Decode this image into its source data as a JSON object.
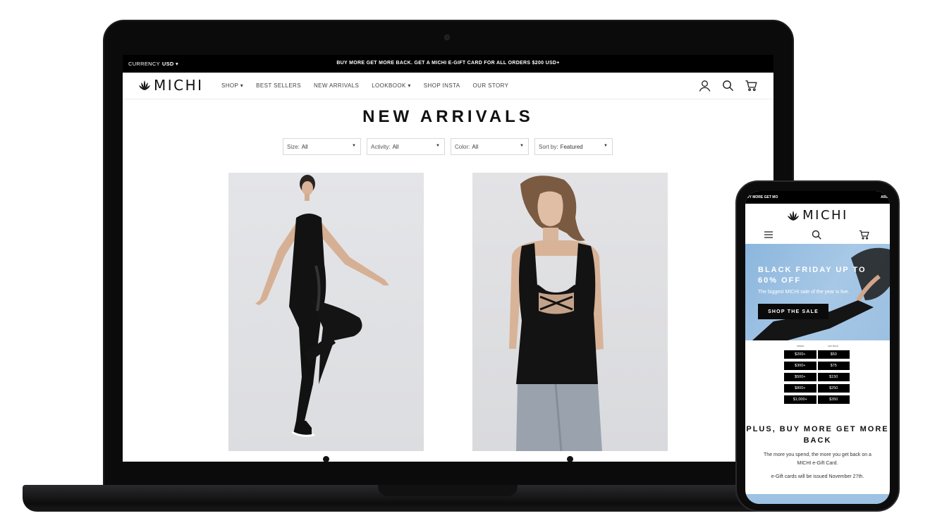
{
  "laptop": {
    "topbar": {
      "currency_label": "CURRENCY",
      "currency_value": "USD",
      "promo": "BUY MORE GET MORE BACK. GET A MICHI E-GIFT CARD FOR ALL ORDERS $200 USD+"
    },
    "nav": {
      "logo": "MICHI",
      "items": [
        "SHOP ▾",
        "BEST SELLERS",
        "NEW ARRIVALS",
        "LOOKBOOK ▾",
        "SHOP INSTA",
        "OUR STORY"
      ],
      "icons": [
        "account-icon",
        "search-icon",
        "cart-icon"
      ]
    },
    "page_title": "NEW ARRIVALS",
    "filters": [
      {
        "label": "Size:",
        "value": "All"
      },
      {
        "label": "Activity:",
        "value": "All"
      },
      {
        "label": "Color:",
        "value": "All"
      },
      {
        "label": "Sort by:",
        "value": "Featured"
      }
    ]
  },
  "phone": {
    "status_left": "UY MORE GET MO",
    "status_right": "ARD",
    "logo": "MICHI",
    "hero": {
      "title": "BLACK FRIDAY UP TO 60% OFF",
      "subtitle": "The biggest MICHI sale of the year is live.",
      "button": "SHOP THE SALE"
    },
    "tiers": {
      "headers": [
        "SPEND",
        "GET BACK"
      ],
      "rows": [
        [
          "$200+",
          "$50"
        ],
        [
          "$300+",
          "$75"
        ],
        [
          "$500+",
          "$150"
        ],
        [
          "$800+",
          "$250"
        ],
        [
          "$1,000+",
          "$350"
        ]
      ]
    },
    "heading": "PLUS, BUY MORE GET MORE BACK",
    "body": "The more you spend, the more you get back on a MICHI e-Gift Card.",
    "note": "e-Gift cards will be issued November 27th."
  },
  "colors": {
    "brand_black": "#000000",
    "hero_blue": "#9cc0e1"
  }
}
